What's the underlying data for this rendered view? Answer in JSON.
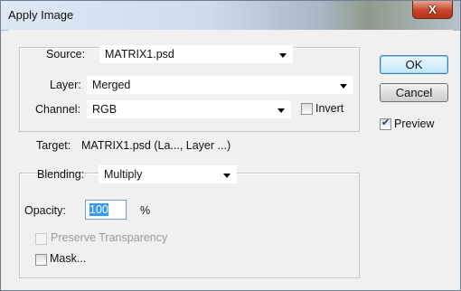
{
  "window": {
    "title": "Apply Image",
    "close_symbol": "X"
  },
  "source": {
    "label": "Source:",
    "value": "MATRIX1.psd"
  },
  "layer": {
    "label": "Layer:",
    "value": "Merged"
  },
  "channel": {
    "label": "Channel:",
    "value": "RGB",
    "invert_label": "Invert",
    "invert_checked": false
  },
  "target": {
    "label": "Target:",
    "value": "MATRIX1.psd (La..., Layer ...)"
  },
  "blending": {
    "label": "Blending:",
    "value": "Multiply"
  },
  "opacity": {
    "label": "Opacity:",
    "value": "100",
    "unit": "%"
  },
  "preserve_transparency": {
    "label": "Preserve Transparency",
    "checked": false,
    "enabled": false
  },
  "mask": {
    "label": "Mask...",
    "checked": false
  },
  "buttons": {
    "ok": "OK",
    "cancel": "Cancel"
  },
  "preview": {
    "label": "Preview",
    "checked": true
  }
}
